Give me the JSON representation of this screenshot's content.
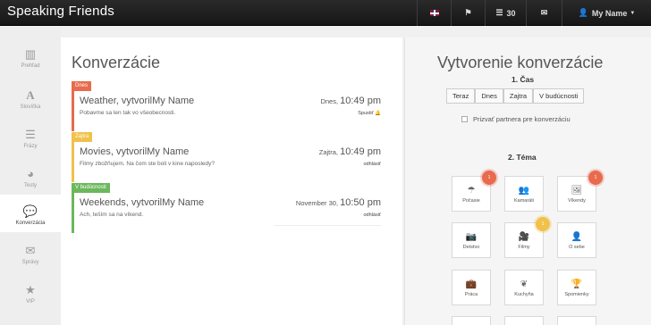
{
  "app": {
    "title": "Speaking Friends"
  },
  "topnav": {
    "messages_count": "30",
    "user_name": "My Name",
    "flag_icon": "uk-flag-icon"
  },
  "sidebar": {
    "items": [
      {
        "label": "Prehľad",
        "icon": "bar-chart-icon"
      },
      {
        "label": "Slovíčka",
        "icon": "letter-a-icon"
      },
      {
        "label": "Frázy",
        "icon": "list-icon"
      },
      {
        "label": "Testy",
        "icon": "gauge-icon"
      },
      {
        "label": "Konverzácia",
        "icon": "chat-bubble-icon"
      },
      {
        "label": "Správy",
        "icon": "envelope-icon"
      },
      {
        "label": "VIP",
        "icon": "star-icon"
      }
    ]
  },
  "main": {
    "title": "Konverzácie",
    "conversations": [
      {
        "tag": "Dnes",
        "tag_color": "#e76b4c",
        "title": "Weather,  vytvorilMy Name",
        "subtitle": "Pobavme sa len tak vo všeobecnosti.",
        "date_prefix": "Dnes,",
        "time": "10:49 pm",
        "action": "Spustiť 🔔"
      },
      {
        "tag": "Zajtra",
        "tag_color": "#f0c14b",
        "title": "Movies,  vytvorilMy Name",
        "subtitle": "Filmy zbožňujem. Na čom ste boli v kine naposledy?",
        "date_prefix": "Zajtra,",
        "time": "10:49 pm",
        "action": "odhlásiť"
      },
      {
        "tag": "V budúcnosti",
        "tag_color": "#6cb85c",
        "title": "Weekends,  vytvorilMy Name",
        "subtitle": "Ach, teším sa na víkend.",
        "date_prefix": "November 30,",
        "time": "10:50 pm",
        "action": "odhlásiť"
      }
    ]
  },
  "create": {
    "title": "Vytvorenie konverzácie",
    "step1": "1. Čas",
    "tabs": [
      "Teraz",
      "Dnes",
      "Zajtra",
      "V budúcnosti"
    ],
    "invite_label": "Prizvať partnera pre konverzáciu",
    "step2": "2. Téma",
    "topics": [
      {
        "label": "Počasie",
        "icon": "umbrella-icon",
        "badge": "1",
        "badge_color": "#e76b4c"
      },
      {
        "label": "Kamaráti",
        "icon": "users-icon",
        "badge": "",
        "badge_color": ""
      },
      {
        "label": "Víkendy",
        "icon": "picture-icon",
        "badge": "1",
        "badge_color": "#e76b4c"
      },
      {
        "label": "Detstvo",
        "icon": "camera-icon",
        "badge": "",
        "badge_color": ""
      },
      {
        "label": "Filmy",
        "icon": "video-camera-icon",
        "badge": "1",
        "badge_color": "#f0c14b"
      },
      {
        "label": "O sebe",
        "icon": "person-icon",
        "badge": "",
        "badge_color": ""
      },
      {
        "label": "Práca",
        "icon": "briefcase-icon",
        "badge": "",
        "badge_color": ""
      },
      {
        "label": "Kuchyňa",
        "icon": "leaf-icon",
        "badge": "",
        "badge_color": ""
      },
      {
        "label": "Spomienky",
        "icon": "trophy-icon",
        "badge": "",
        "badge_color": ""
      }
    ]
  }
}
